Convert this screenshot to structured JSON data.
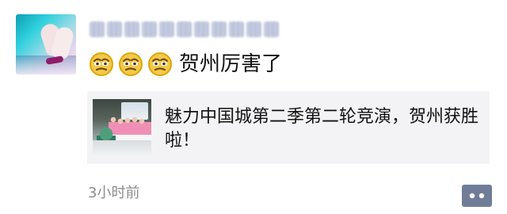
{
  "post": {
    "text": "贺州厉害了",
    "emoji_icon": "emoji-face-icon",
    "shared_link": {
      "title": "魅力中国城第二季第二轮竞演，贺州获胜啦！"
    },
    "time": "3小时前"
  },
  "colors": {
    "text_primary": "#111111",
    "text_secondary": "#8d8d8d",
    "card_background": "#f3f3f5",
    "comment_button": "#6f7d99"
  },
  "icons": {
    "avatar": "avatar-icon",
    "comment": "comment-icon"
  }
}
